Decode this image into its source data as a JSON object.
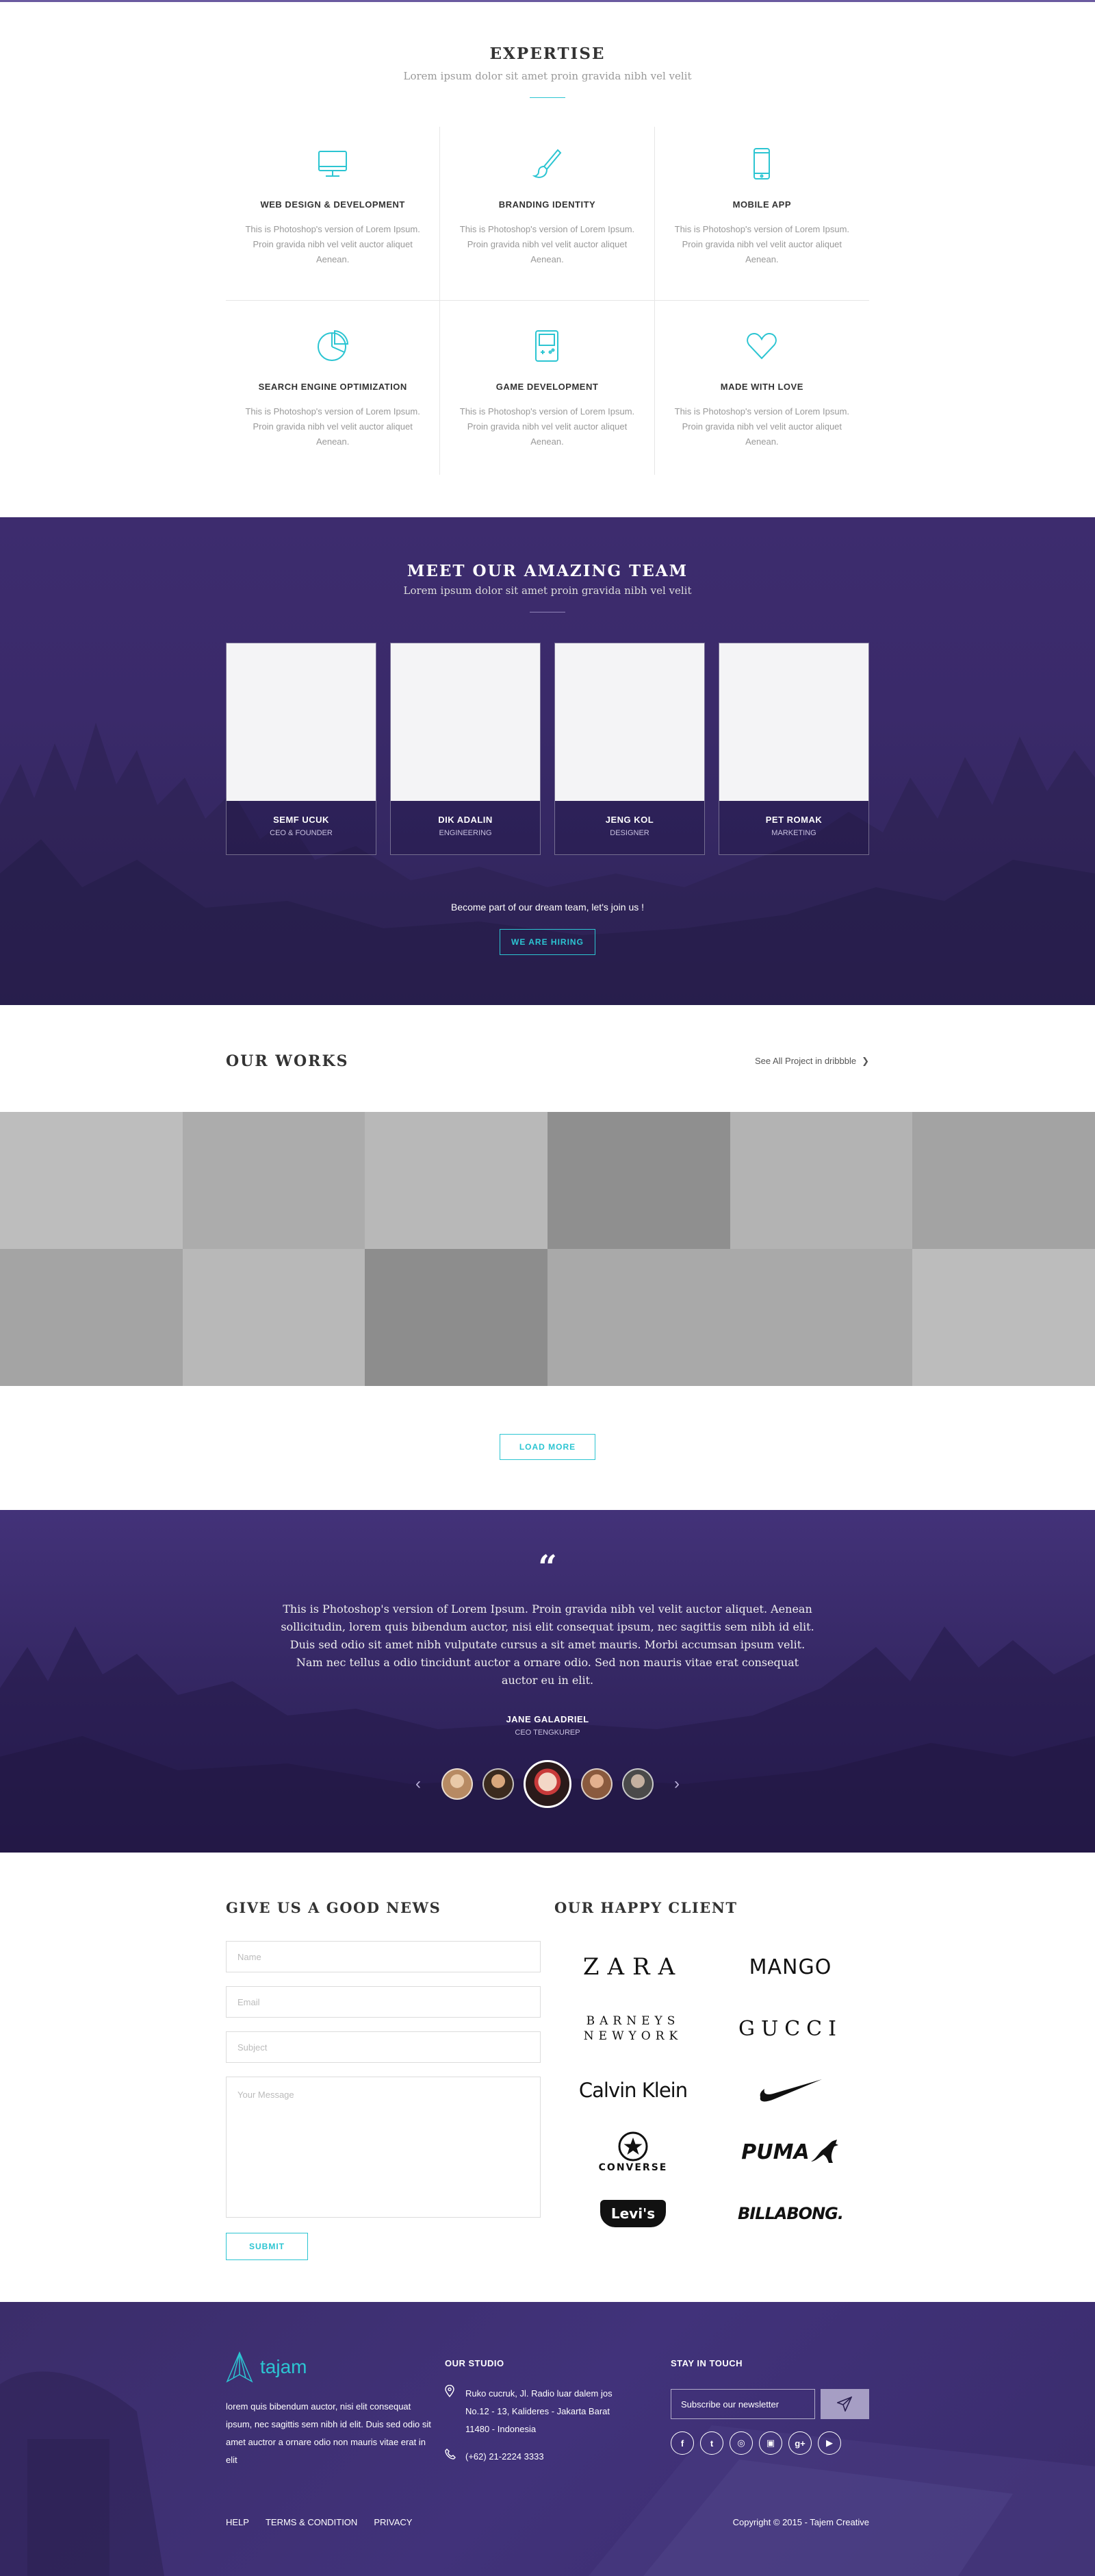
{
  "expertise": {
    "title": "EXPERTISE",
    "subtitle": "Lorem ipsum dolor sit amet proin gravida nibh vel velit",
    "items": [
      {
        "name": "WEB DESIGN & DEVELOPMENT",
        "desc": "This is Photoshop's version  of Lorem Ipsum. Proin gravida nibh vel velit auctor aliquet Aenean.",
        "icon": "monitor-icon"
      },
      {
        "name": "BRANDING IDENTITY",
        "desc": "This is Photoshop's version  of Lorem Ipsum. Proin gravida nibh vel velit auctor aliquet Aenean.",
        "icon": "brush-icon"
      },
      {
        "name": "MOBILE APP",
        "desc": "This is Photoshop's version  of Lorem Ipsum. Proin gravida nibh vel velit auctor aliquet Aenean.",
        "icon": "phone-icon"
      },
      {
        "name": "SEARCH ENGINE OPTIMIZATION",
        "desc": "This is Photoshop's version  of Lorem Ipsum. Proin gravida nibh vel velit auctor aliquet Aenean.",
        "icon": "pie-chart-icon"
      },
      {
        "name": "GAME DEVELOPMENT",
        "desc": "This is Photoshop's version  of Lorem Ipsum. Proin gravida nibh vel velit auctor aliquet Aenean.",
        "icon": "gameboy-icon"
      },
      {
        "name": "MADE WITH LOVE",
        "desc": "This is Photoshop's version  of Lorem Ipsum. Proin gravida nibh vel velit auctor aliquet Aenean.",
        "icon": "heart-icon"
      }
    ]
  },
  "team": {
    "title": "MEET OUR AMAZING TEAM",
    "subtitle": "Lorem ipsum dolor sit amet proin gravida nibh vel velit",
    "members": [
      {
        "name": "SEMF UCUK",
        "role": "CEO & FOUNDER"
      },
      {
        "name": "DIK ADALIN",
        "role": "ENGINEERING"
      },
      {
        "name": "JENG KOL",
        "role": "DESIGNER"
      },
      {
        "name": "PET ROMAK",
        "role": "MARKETING"
      }
    ],
    "join_text": "Become part of our dream team, let's join us !",
    "hiring_button": "WE ARE HIRING"
  },
  "works": {
    "title": "OUR WORKS",
    "link": "See All Project in dribbble",
    "tiles": [
      "#bdbdbd",
      "#acacac",
      "#b8b8b8",
      "#8f8f8f",
      "#b3b3b3",
      "#a3a3a3",
      "#a4a4a4",
      "#b8b8b8",
      "#8d8d8d",
      "#a9a9a9",
      "#a9a9a9",
      "#bcbcbc"
    ],
    "load_more": "LOAD MORE"
  },
  "testimonial": {
    "quote_mark": "“",
    "text": "This is Photoshop's version  of Lorem Ipsum. Proin gravida nibh vel velit auctor aliquet. Aenean sollicitudin, lorem quis bibendum auctor, nisi elit consequat ipsum, nec sagittis sem nibh id elit. Duis sed odio sit amet nibh vulputate cursus a sit amet mauris. Morbi accumsan ipsum velit. Nam nec tellus a odio tincidunt auctor a ornare odio. Sed non  mauris vitae erat consequat auctor eu in elit.",
    "name": "JANE GALADRIEL",
    "role": "CEO TENGKUREP"
  },
  "contact": {
    "title": "GIVE US A GOOD NEWS",
    "name_placeholder": "Name",
    "email_placeholder": "Email",
    "subject_placeholder": "Subject",
    "message_placeholder": "Your Message",
    "submit": "SUBMIT"
  },
  "clients": {
    "title": "OUR HAPPY CLIENT",
    "zara": "ZARA",
    "mango": "MANGO",
    "barneys_1": "BARNEYS",
    "barneys_2": "NEWYORK",
    "gucci": "GUCCI",
    "calvin": "Calvin Klein",
    "converse": "CONVERSE",
    "puma": "PUMA",
    "levis": "Levi's",
    "billabong": "BILLABONG."
  },
  "footer": {
    "logo": "tajam",
    "about": "lorem quis bibendum auctor, nisi elit consequat ipsum, nec sagittis sem nibh id elit. Duis sed odio sit amet auctror a ornare odio non mauris vitae erat in elit",
    "studio_title": "OUR STUDIO",
    "address": "Ruko cucruk, Jl. Radio luar dalem jos No.12 - 13, Kalideres - Jakarta Barat 11480 - Indonesia",
    "phone": "(+62) 21-2224 3333",
    "touch_title": "STAY IN TOUCH",
    "newsletter_placeholder": "Subscribe our newsletter",
    "links": [
      "HELP",
      "TERMS & CONDITION",
      "PRIVACY"
    ],
    "copyright": "Copyright © 2015 - Tajem Creative"
  },
  "colors": {
    "accent": "#2cc5d2",
    "purple": "#3d2c6e"
  }
}
